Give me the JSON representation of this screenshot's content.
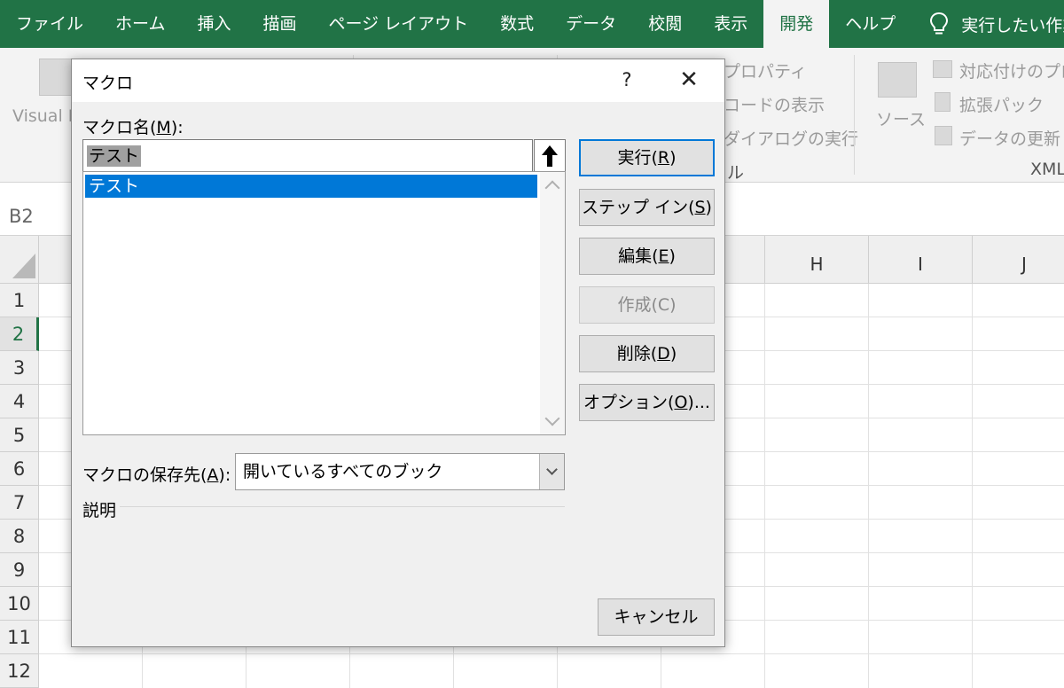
{
  "ribbon": {
    "tabs": [
      {
        "label": "ファイル"
      },
      {
        "label": "ホーム"
      },
      {
        "label": "挿入"
      },
      {
        "label": "描画"
      },
      {
        "label": "ページ レイアウト"
      },
      {
        "label": "数式"
      },
      {
        "label": "データ"
      },
      {
        "label": "校閲"
      },
      {
        "label": "表示"
      },
      {
        "label": "開発",
        "active": true
      },
      {
        "label": "ヘルプ"
      }
    ],
    "tell_me": "実行したい作業",
    "visual_basic": "Visual B",
    "properties": "プロパティ",
    "view_code": "コードの表示",
    "run_dialog": "ダイアログの実行",
    "controls_group": "ル",
    "source": "ソース",
    "map_properties": "対応付けのプロ",
    "expansion_packs": "拡張パック",
    "refresh_data": "データの更新",
    "xml_group": "XML"
  },
  "formula_bar": {
    "name_box": "B2"
  },
  "sheet": {
    "visible_columns": [
      "H",
      "I",
      "J"
    ],
    "rows": [
      "1",
      "2",
      "3",
      "4",
      "5",
      "6",
      "7",
      "8",
      "9",
      "10",
      "11",
      "12"
    ],
    "selected_row": "2"
  },
  "dialog": {
    "title": "マクロ",
    "help": "?",
    "close": "✕",
    "macro_name_label_prefix": "マクロ名(",
    "macro_name_label_key": "M",
    "macro_name_label_suffix": "):",
    "macro_name_value": "テスト",
    "macros": [
      "テスト"
    ],
    "buttons": {
      "run_prefix": "実行(",
      "run_key": "R",
      "run_suffix": ")",
      "step_prefix": "ステップ イン(",
      "step_key": "S",
      "step_suffix": ")",
      "edit_prefix": "編集(",
      "edit_key": "E",
      "edit_suffix": ")",
      "create": "作成(C)",
      "delete_prefix": "削除(",
      "delete_key": "D",
      "delete_suffix": ")",
      "options_prefix": "オプション(",
      "options_key": "O",
      "options_suffix": ")...",
      "cancel": "キャンセル"
    },
    "save_location_label_prefix": "マクロの保存先(",
    "save_location_label_key": "A",
    "save_location_label_suffix": "):",
    "save_location_value": "開いているすべてのブック",
    "description_label": "説明"
  }
}
